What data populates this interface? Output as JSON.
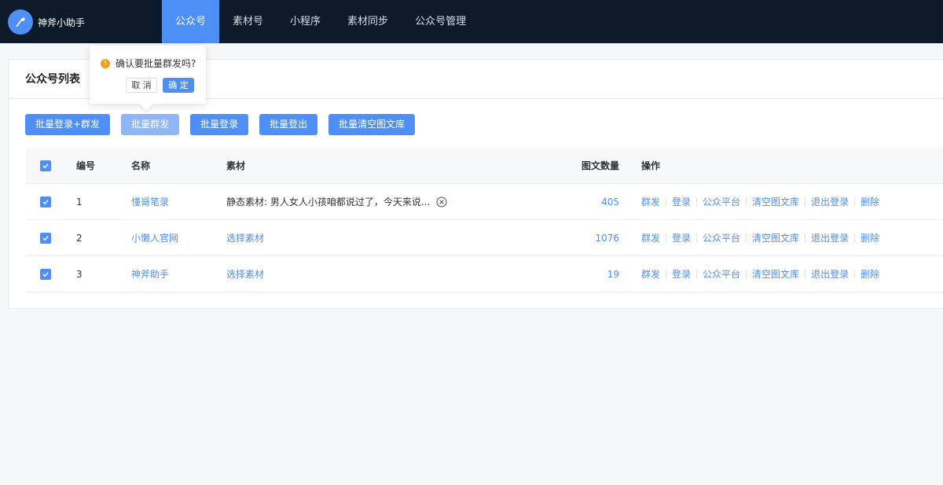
{
  "app": {
    "title": "神斧小助手"
  },
  "nav": {
    "items": [
      {
        "label": "公众号",
        "active": true
      },
      {
        "label": "素材号"
      },
      {
        "label": "小程序"
      },
      {
        "label": "素材同步"
      },
      {
        "label": "公众号管理"
      }
    ]
  },
  "card": {
    "title": "公众号列表"
  },
  "toolbar": {
    "batch_login_send": "批量登录+群发",
    "batch_send": "批量群发",
    "batch_login": "批量登录",
    "batch_logout": "批量登出",
    "batch_clear": "批量清空图文库"
  },
  "table": {
    "headers": {
      "num": "编号",
      "name": "名称",
      "material": "素材",
      "count": "图文数量",
      "ops": "操作"
    },
    "rows": [
      {
        "num": "1",
        "name": "懂哥笔录",
        "material": "静态素材: 男人女人小孩咱都说过了，今天来说...",
        "material_clearable": true,
        "count": "405"
      },
      {
        "num": "2",
        "name": "小懒人官网",
        "material": "选择素材",
        "count": "1076"
      },
      {
        "num": "3",
        "name": "神斧助手",
        "material": "选择素材",
        "count": "19"
      }
    ],
    "ops": [
      "群发",
      "登录",
      "公众平台",
      "清空图文库",
      "退出登录",
      "删除"
    ]
  },
  "popover": {
    "message": "确认要批量群发吗?",
    "cancel": "取 消",
    "confirm": "确 定"
  },
  "colors": {
    "primary": "#4d8ff5",
    "topbar": "#0d1a2a",
    "warning": "#f0a020"
  },
  "icons": {
    "logo": "axe-icon",
    "check": "check-icon",
    "clear": "circle-close-icon",
    "warning": "warning-icon"
  }
}
